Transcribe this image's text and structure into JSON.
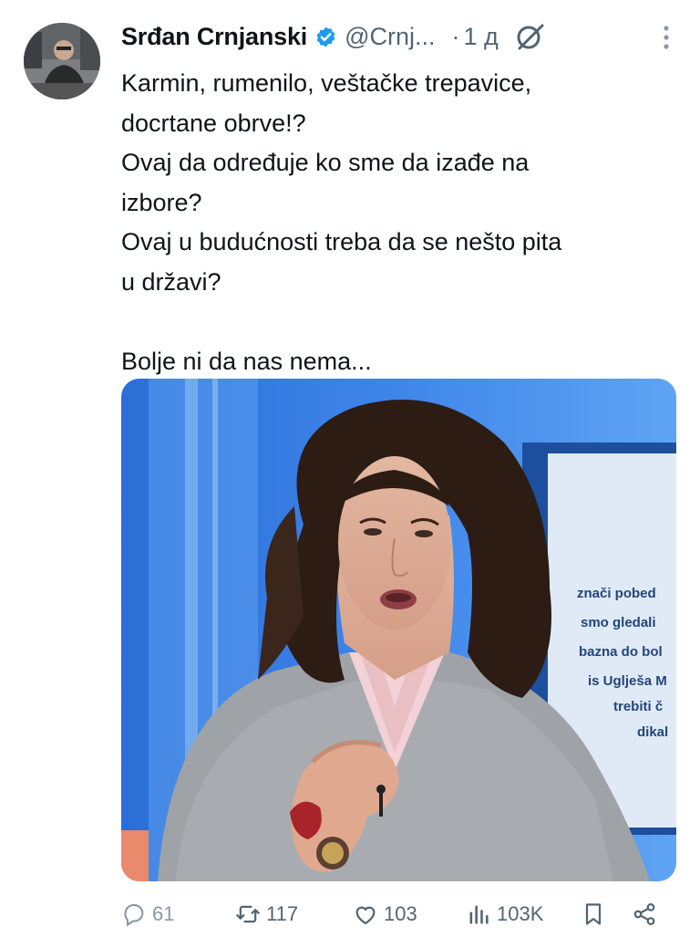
{
  "tweet": {
    "author_name": "Srđan Crnjanski",
    "handle": "@Crnj...",
    "separator": "·",
    "time": "1 д",
    "text": "Karmin, rumenilo, veštačke trepavice,\ndocrtane obrve!?\nOvaj da određuje ko sme da izađe na\nizbore?\nOvaj u budućnosti treba da se nešto pita\nu državi?\n\nBolje ni da nas nema..."
  },
  "media": {
    "caption_lines": [
      "znači pobed",
      "smo gledali",
      "bazna do bol",
      "is Uglješa M",
      "trebiti č",
      "dikal"
    ]
  },
  "actions": {
    "replies": "61",
    "reposts": "117",
    "likes": "103",
    "views": "103K"
  },
  "icons": {
    "verified": "verified-badge-icon",
    "grok": "grok-icon",
    "more": "more-vertical-icon",
    "reply": "reply-icon",
    "repost": "repost-icon",
    "like": "heart-icon",
    "views": "views-chart-icon",
    "bookmark": "bookmark-icon",
    "share": "share-icon"
  },
  "colors": {
    "text": "#0f1419",
    "secondary": "#536471",
    "verified": "#1d9bf0"
  }
}
